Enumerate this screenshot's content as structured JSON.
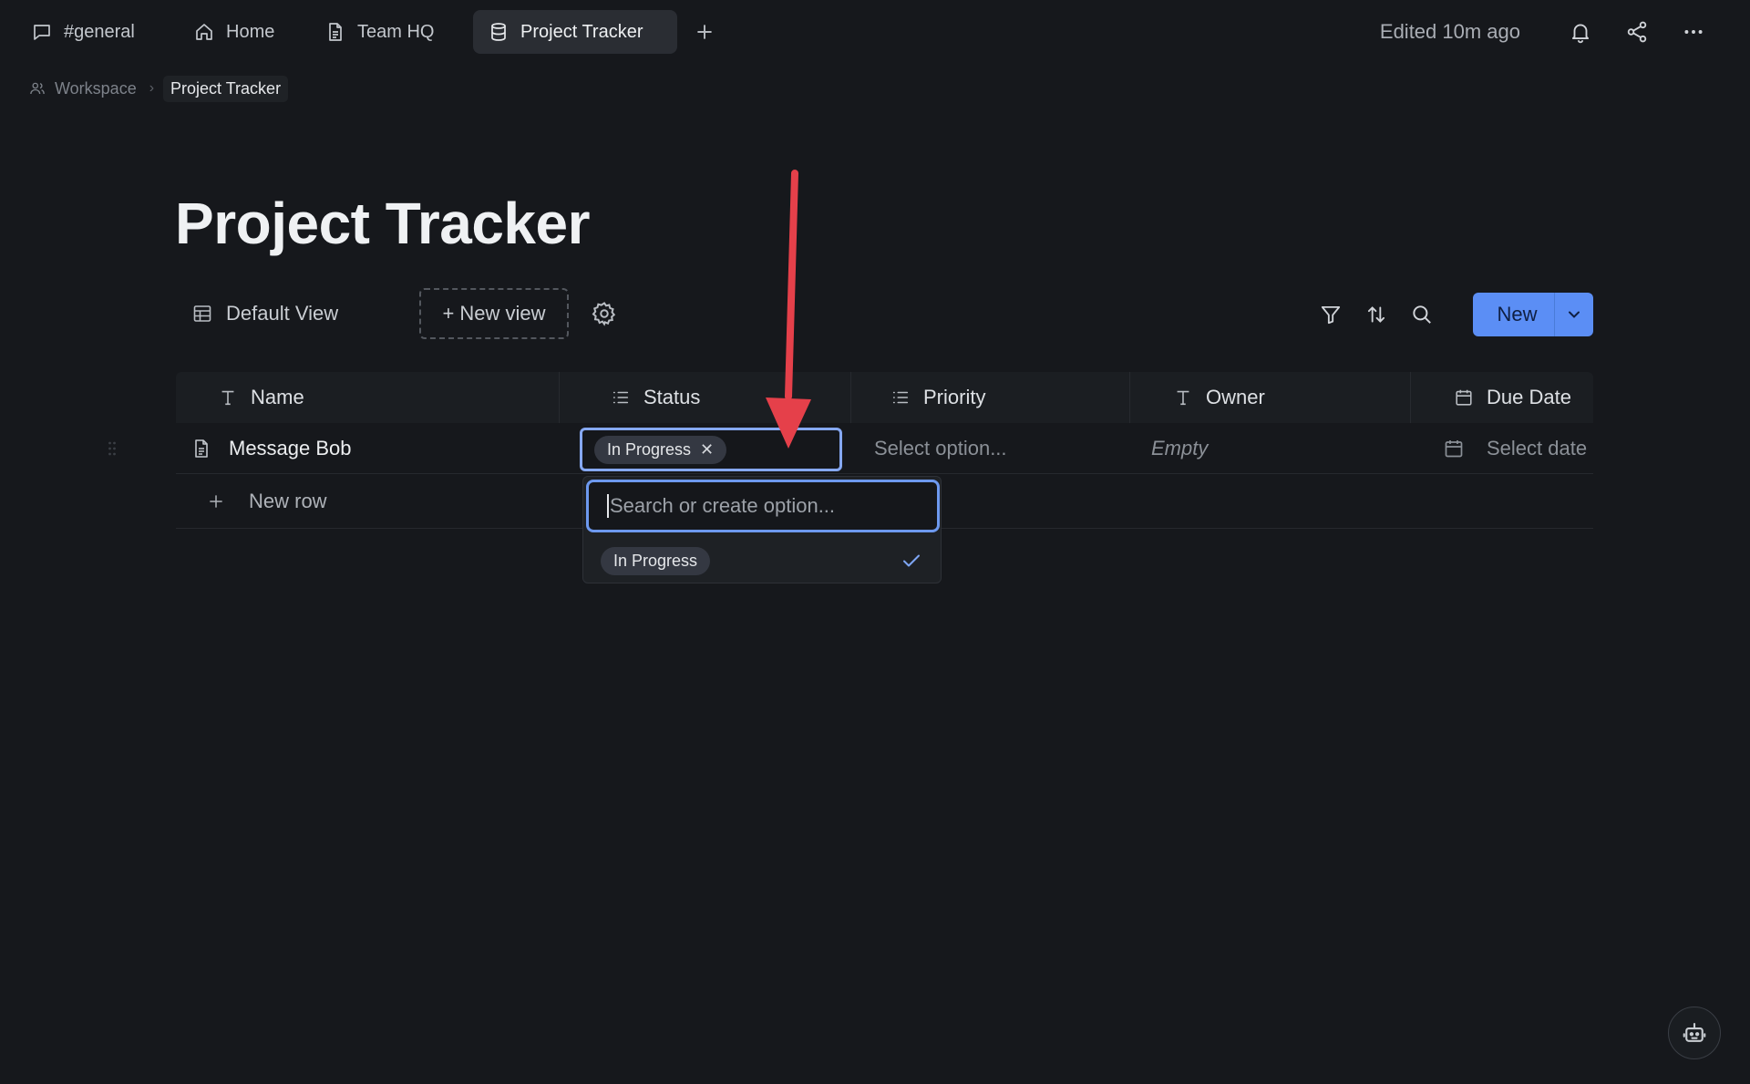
{
  "tabs": [
    {
      "label": "#general",
      "icon": "chat-bubble-icon"
    },
    {
      "label": "Home",
      "icon": "home-icon"
    },
    {
      "label": "Team HQ",
      "icon": "document-icon"
    },
    {
      "label": "Project Tracker",
      "icon": "database-icon",
      "active": true
    }
  ],
  "header": {
    "edited": "Edited 10m ago"
  },
  "breadcrumb": {
    "workspace": "Workspace",
    "current": "Project Tracker"
  },
  "page": {
    "title": "Project Tracker"
  },
  "views": {
    "default_label": "Default View",
    "new_view_label": "+ New view"
  },
  "toolbar": {
    "new_label": "New"
  },
  "table": {
    "columns": [
      {
        "label": "Name",
        "icon": "text-icon"
      },
      {
        "label": "Status",
        "icon": "list-icon"
      },
      {
        "label": "Priority",
        "icon": "list-icon"
      },
      {
        "label": "Owner",
        "icon": "text-icon"
      },
      {
        "label": "Due Date",
        "icon": "calendar-icon"
      }
    ],
    "rows": [
      {
        "name": "Message Bob",
        "status": "In Progress",
        "priority_placeholder": "Select option...",
        "owner_placeholder": "Empty",
        "due_placeholder": "Select date"
      }
    ],
    "new_row_label": "New row"
  },
  "status_dropdown": {
    "search_placeholder": "Search or create option...",
    "options": [
      {
        "label": "In Progress",
        "selected": true
      }
    ]
  },
  "colors": {
    "accent": "#5b8ef5",
    "focus_border": "#86a8f2",
    "annotation_arrow": "#e5404a",
    "background": "#16181c"
  }
}
